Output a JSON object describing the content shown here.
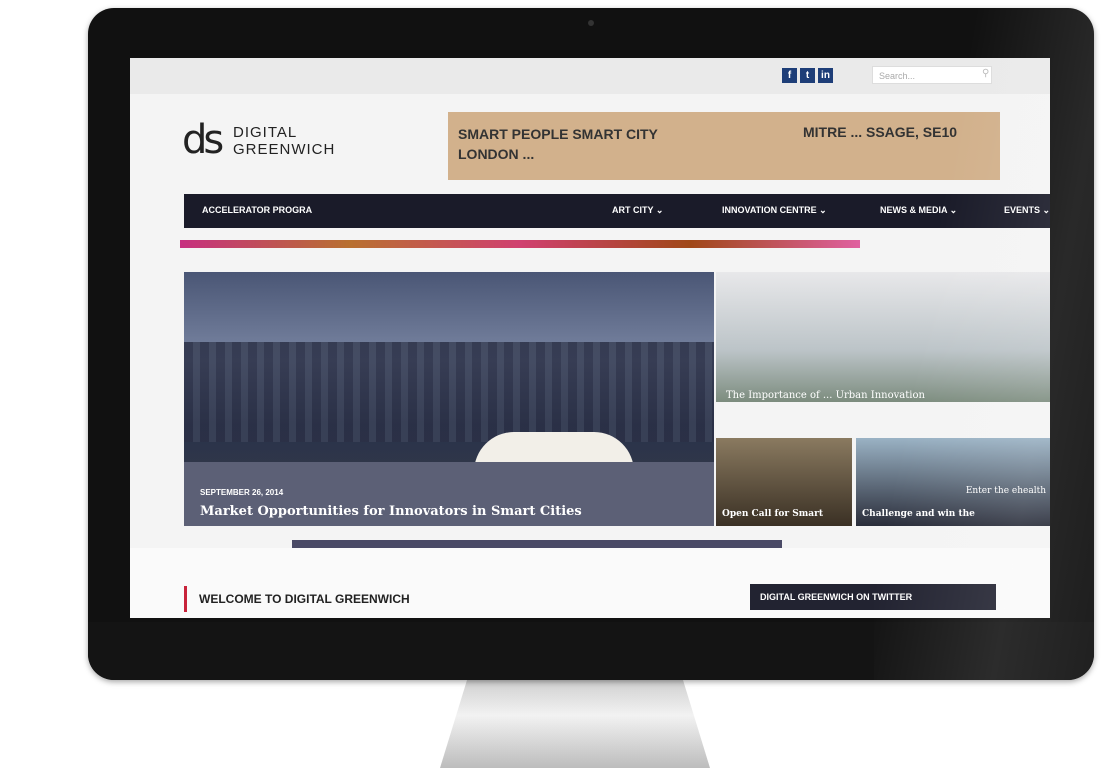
{
  "topbar": {
    "social": [
      "f",
      "t",
      "in"
    ],
    "search_placeholder": "Search..."
  },
  "logo": {
    "mark": "ds",
    "line1": "DIGITAL",
    "line2": "GREENWICH"
  },
  "banner": {
    "left_line1": "SMART PEOPLE SMART CITY",
    "left_line2": "LONDON ...",
    "right": "MITRE ... SSAGE, SE10"
  },
  "nav": {
    "items": [
      "ACCELERATOR PROGRA",
      "ART CITY ⌄",
      "INNOVATION CENTRE ⌄",
      "NEWS & MEDIA ⌄",
      "EVENTS ⌄"
    ]
  },
  "hero": {
    "date": "SEPTEMBER 26, 2014",
    "title": "Market Opportunities for Innovators in Smart Cities"
  },
  "side": {
    "caption": "The Importance of ... Urban Innovation",
    "card1_title": "Open Call for Smart",
    "card2_title": "Challenge and win the",
    "card2_overlay": "Enter the ehealth"
  },
  "bottom": {
    "welcome": "WELCOME TO DIGITAL GREENWICH",
    "twitter": "DIGITAL GREENWICH ON TWITTER"
  },
  "colors": {
    "accent": "#c8233a",
    "nav_bg": "#1a1b29",
    "banner_bg": "#d2b18c"
  }
}
